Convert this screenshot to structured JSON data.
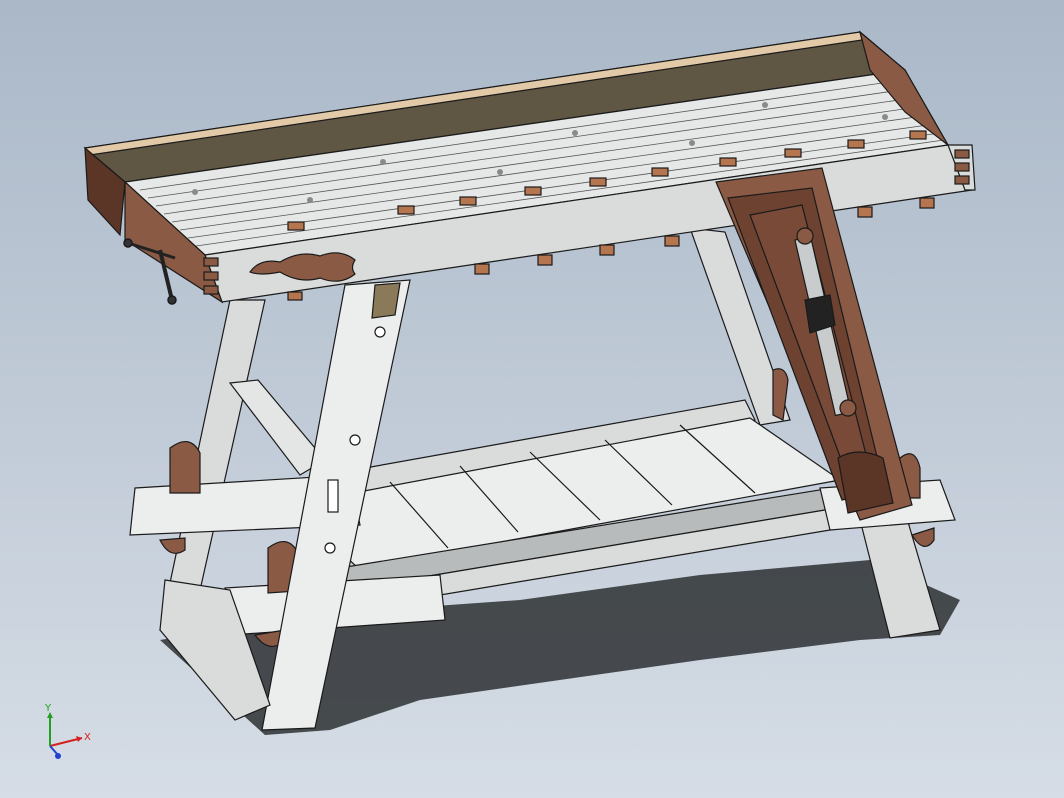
{
  "viewport": {
    "colors": {
      "wood": "#8b5a45",
      "wood_dark": "#5b3526",
      "face_light": "#eceeed",
      "face_mid": "#d9dcdb",
      "face_dark": "#b7bbbb",
      "tray": "#5f5644",
      "edge": "#1a1a1a",
      "shadow": "#2d3033"
    }
  },
  "triad": {
    "x_label": "X",
    "y_label": "Y",
    "colors": {
      "x": "#d32020",
      "y": "#20a020",
      "z": "#2040d0"
    }
  }
}
